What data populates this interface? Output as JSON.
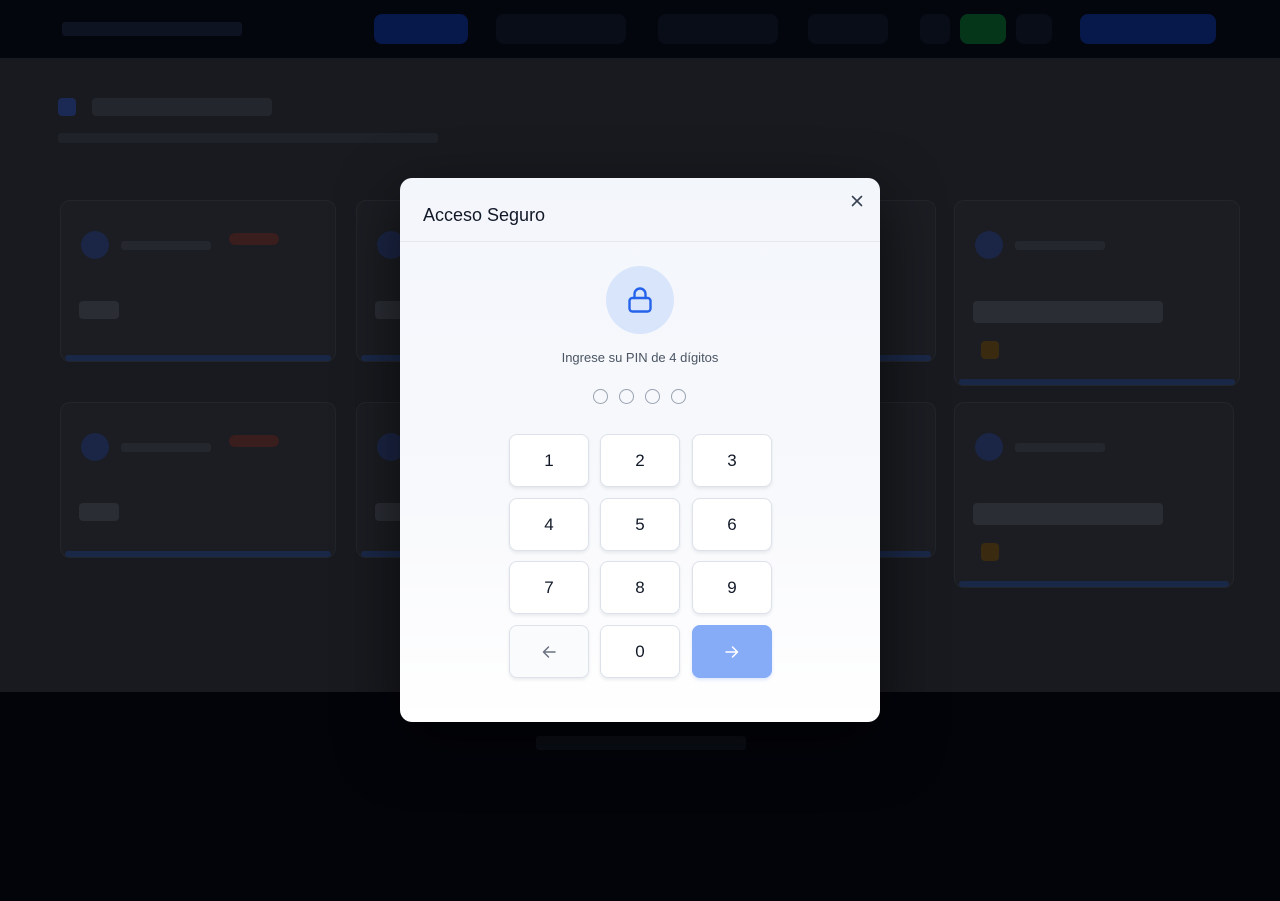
{
  "modal": {
    "title": "Acceso Seguro",
    "prompt": "Ingrese su PIN de 4 dígitos",
    "pin_length": 4,
    "pin_filled": 0
  },
  "keypad": {
    "keys": [
      "1",
      "2",
      "3",
      "4",
      "5",
      "6",
      "7",
      "8",
      "9",
      "0"
    ],
    "back_icon": "arrow-left-icon",
    "submit_icon": "arrow-right-icon"
  },
  "icons": {
    "close": "close-icon",
    "lock": "lock-icon"
  },
  "colors": {
    "accent": "#2563eb",
    "lock_bg": "#d8e5fb",
    "submit_bg": "#86acf8",
    "overlay": "#181a1f"
  }
}
